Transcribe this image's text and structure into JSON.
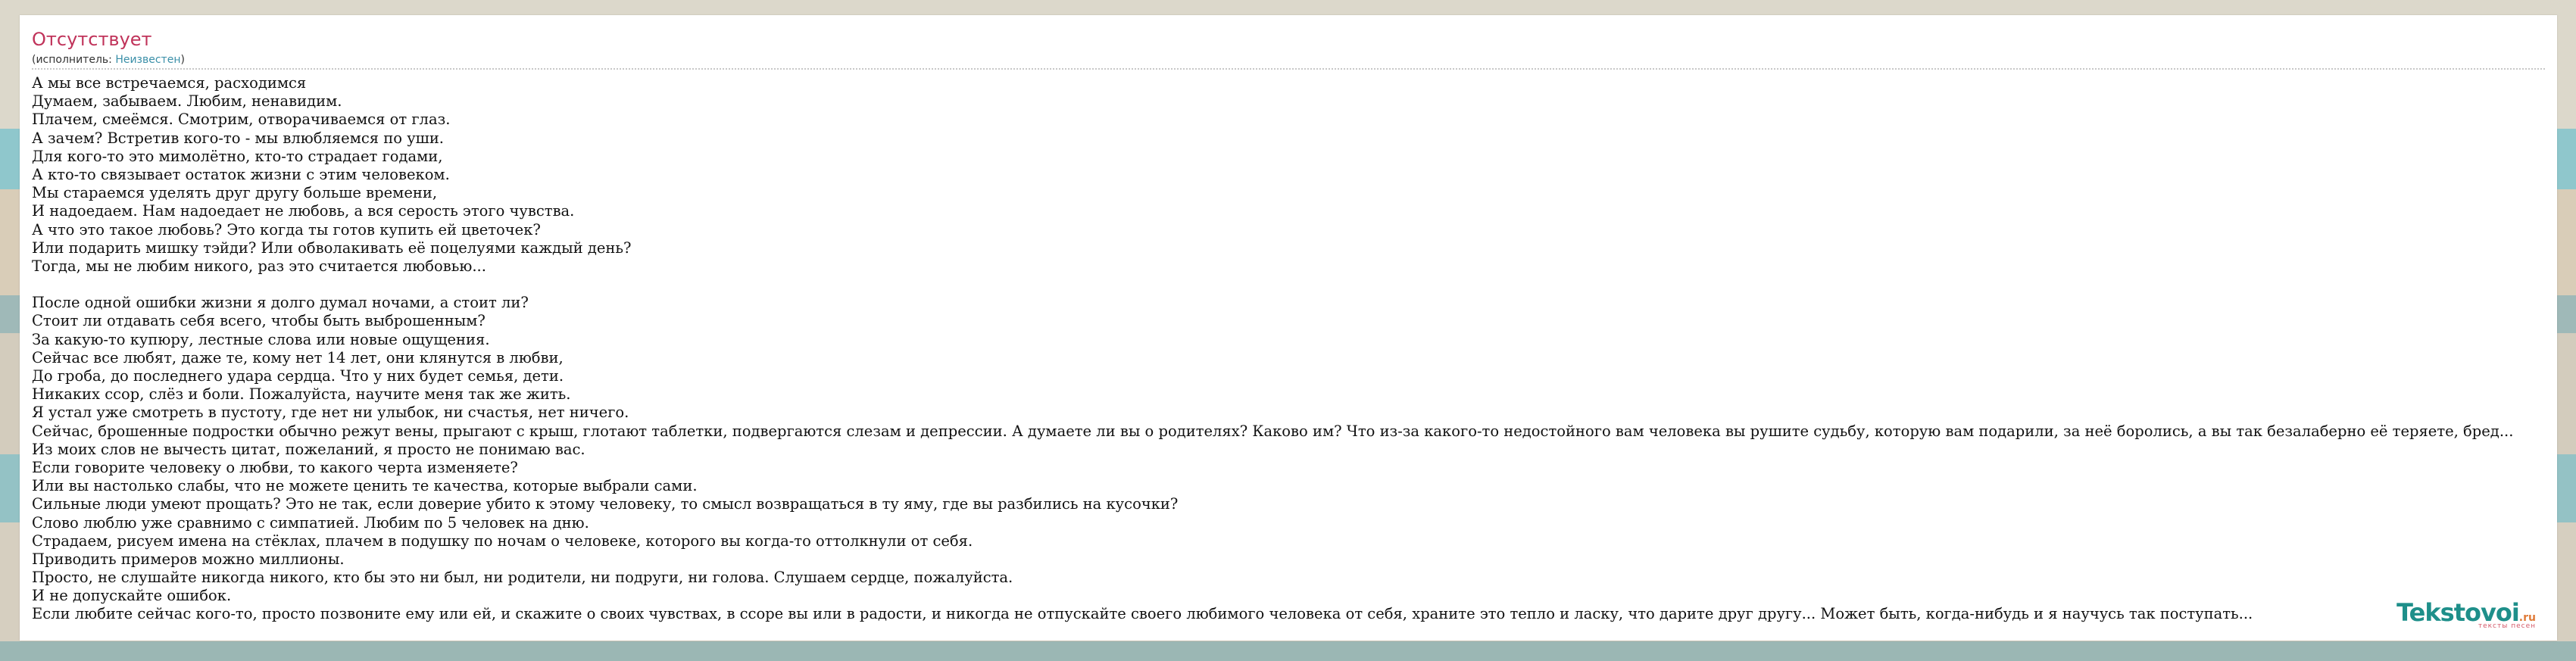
{
  "song": {
    "title": "Отсутствует",
    "performer_prefix": "(исполнитель: ",
    "performer_name": "Неизвестен",
    "performer_suffix": ")"
  },
  "lyrics": [
    "А мы все встречаемся, расходимся",
    "Думаем, забываем. Любим, ненавидим.",
    "Плачем, смеёмся. Смотрим, отворачиваемся от глаз.",
    "А зачем? Встретив кого-то - мы влюбляемся по уши.",
    "Для кого-то это мимолётно, кто-то страдает годами,",
    "А кто-то связывает остаток жизни с этим человеком.",
    "Мы стараемся уделять друг другу больше времени,",
    "И надоедаем. Нам надоедает не любовь, а вся серость этого чувства.",
    "А что это такое любовь? Это когда ты готов купить ей цветочек?",
    "Или подарить мишку тэйди? Или обволакивать её поцелуями каждый день?",
    "Тогда, мы не любим никого, раз это считается любовью...",
    "",
    "После одной ошибки жизни я долго думал ночами, а стоит ли?",
    "Стоит ли отдавать себя всего, чтобы быть выброшенным?",
    "За какую-то купюру, лестные слова или новые ощущения.",
    "Сейчас все любят, даже те, кому нет 14 лет, они клянутся в любви,",
    "До гроба, до последнего удара сердца. Что у них будет семья, дети.",
    "Никаких ссор, слёз и боли. Пожалуйста, научите меня так же жить.",
    "Я устал уже смотреть в пустоту, где нет ни улыбок, ни счастья, нет ничего.",
    "Сейчас, брошенные подростки обычно режут вены, прыгают с крыш, глотают таблетки, подвергаются слезам и депрессии. А думаете ли вы о родителях? Каково им? Что из-за какого-то недостойного вам человека вы рушите судьбу, которую вам подарили, за неё боролись, а вы так безалаберно её теряете, бред...",
    "Из моих слов не вычесть цитат, пожеланий, я просто не понимаю вас.",
    "Если говорите человеку о любви, то какого черта изменяете?",
    "Или вы настолько слабы, что не можете ценить те качества, которые выбрали сами.",
    "Сильные люди умеют прощать? Это не так, если доверие убито к этому человеку, то смысл возвращаться в ту яму, где вы разбились на кусочки?",
    "Слово люблю уже сравнимо с симпатией. Любим по 5 человек на дню.",
    "Страдаем, рисуем имена на стёклах, плачем в подушку по ночам о человеке, которого вы когда-то оттолкнули от себя.",
    "Приводить примеров можно миллионы.",
    "Просто, не слушайте никогда никого, кто бы это ни был, ни родители, ни подруги, ни голова. Слушаем сердце, пожалуйста.",
    "И не допускайте ошибок.",
    "Если любите сейчас кого-то, просто позвоните ему или ей, и скажите о своих чувствах, в ссоре вы или в радости, и никогда не отпускайте своего любимого человека от себя, храните это тепло и ласку, что дарите друг другу... Может быть, когда-нибудь и я научусь так поступать..."
  ],
  "logo": {
    "main": "Tekstovoi",
    "tld": ".ru",
    "tagline": "тексты песен"
  },
  "colors": {
    "title": "#c0335a",
    "link": "#3a8fa8",
    "logo": "#1e8f8a"
  }
}
